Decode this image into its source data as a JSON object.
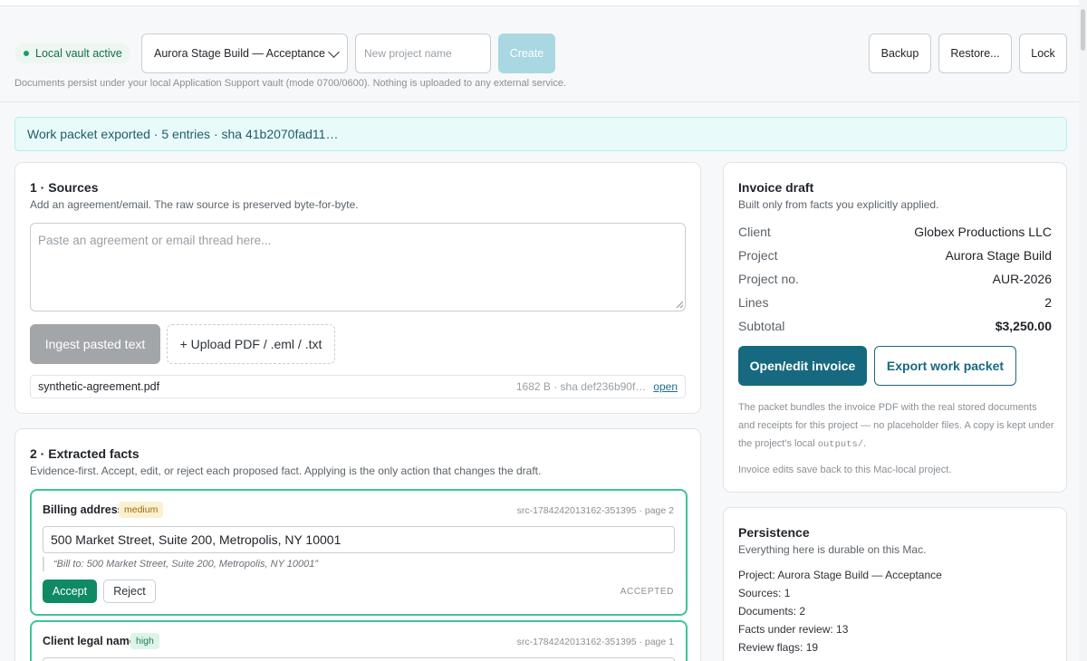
{
  "header": {
    "vault_status": "Local vault active",
    "project_select_value": "Aurora Stage Build — Acceptance",
    "new_project_placeholder": "New project name",
    "create_label": "Create",
    "backup_label": "Backup",
    "restore_label": "Restore...",
    "lock_label": "Lock",
    "note": "Documents persist under your local Application Support vault (mode 0700/0600). Nothing is uploaded to any external service."
  },
  "banner": {
    "text": "Work packet exported · 5 entries · sha 41b2070fad11…"
  },
  "sources": {
    "title": "1 · Sources",
    "subtitle": "Add an agreement/email. The raw source is preserved byte-for-byte.",
    "paste_placeholder": "Paste an agreement or email thread here...",
    "ingest_label": "Ingest pasted text",
    "upload_label": "+ Upload PDF / .eml / .txt",
    "files": [
      {
        "name": "synthetic-agreement.pdf",
        "meta": "1682 B · sha def236b90f…",
        "open_label": "open"
      }
    ]
  },
  "facts": {
    "title": "2 · Extracted facts",
    "subtitle": "Evidence-first. Accept, edit, or reject each proposed fact. Applying is the only action that changes the draft.",
    "items": [
      {
        "label": "Billing address",
        "confidence": "medium",
        "source": "src-1784242013162-351395 · page 2",
        "value": "500 Market Street, Suite 200, Metropolis, NY 10001",
        "quote": "“Bill to: 500 Market Street, Suite 200, Metropolis, NY 10001”",
        "accept_label": "Accept",
        "reject_label": "Reject",
        "status": "ACCEPTED"
      },
      {
        "label": "Client legal name",
        "confidence": "high",
        "source": "src-1784242013162-351395 · page 1"
      }
    ]
  },
  "invoice": {
    "title": "Invoice draft",
    "subtitle": "Built only from facts you explicitly applied.",
    "rows": [
      {
        "key": "Client",
        "value": "Globex Productions LLC"
      },
      {
        "key": "Project",
        "value": "Aurora Stage Build"
      },
      {
        "key": "Project no.",
        "value": "AUR-2026"
      },
      {
        "key": "Lines",
        "value": "2"
      },
      {
        "key": "Subtotal",
        "value": "$3,250.00"
      }
    ],
    "open_edit_label": "Open/edit invoice",
    "export_label": "Export work packet",
    "note_before_code": "The packet bundles the invoice PDF with the real stored documents and receipts for this project — no placeholder files. A copy is kept under the project's local ",
    "note_code": "outputs/",
    "note_after_code": ".",
    "note2": "Invoice edits save back to this Mac-local project."
  },
  "persistence": {
    "title": "Persistence",
    "subtitle": "Everything here is durable on this Mac.",
    "lines": [
      "Project: Aurora Stage Build — Acceptance",
      "Sources: 1",
      "Documents: 2",
      "Facts under review: 13",
      "Review flags: 19"
    ]
  },
  "colors": {
    "accent": "#17697f",
    "accepted_border": "#3dc59a",
    "accept_button": "#0f8a63",
    "vault_badge_text": "#12704a"
  }
}
